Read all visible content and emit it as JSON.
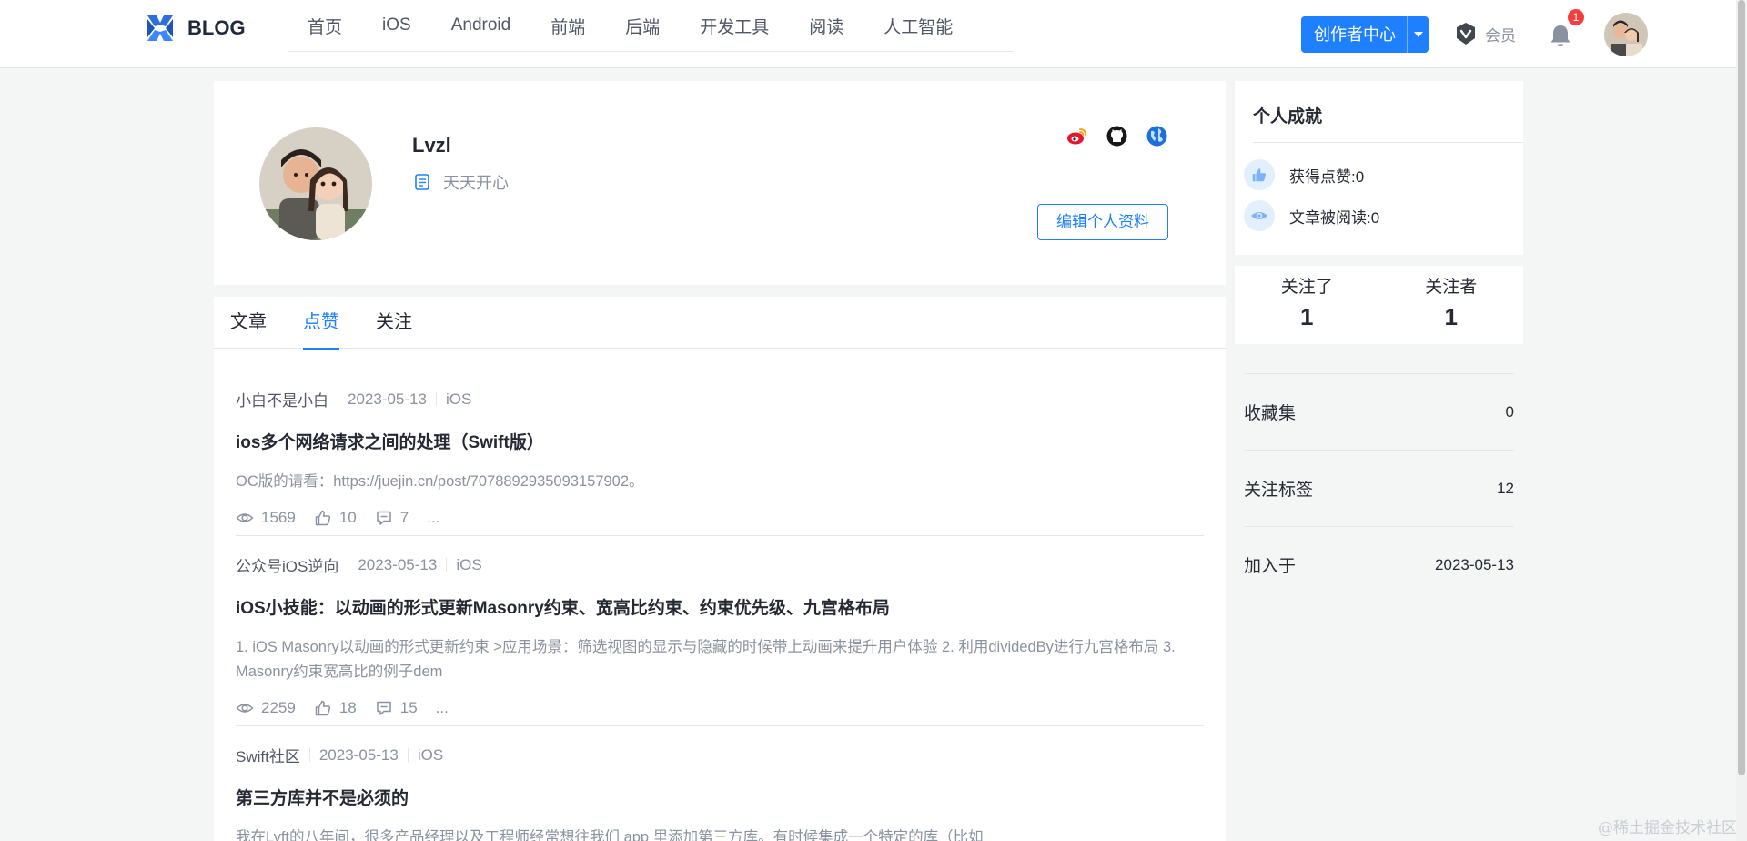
{
  "header": {
    "logo_text": "BLOG",
    "nav": [
      "首页",
      "iOS",
      "Android",
      "前端",
      "后端",
      "开发工具",
      "阅读",
      "人工智能"
    ],
    "creator_label": "创作者中心",
    "vip_label": "会员",
    "notification_count": "1",
    "accent": "#1e80ff"
  },
  "profile": {
    "name": "Lvzl",
    "signature": "天天开心",
    "edit_label": "编辑个人资料",
    "social_icons": [
      "weibo-icon",
      "github-icon",
      "website-icon"
    ]
  },
  "tabs": [
    {
      "label": "文章",
      "active": false
    },
    {
      "label": "点赞",
      "active": true
    },
    {
      "label": "关注",
      "active": false
    }
  ],
  "articles": [
    {
      "author": "小白不是小白",
      "date": "2023-05-13",
      "tag": "iOS",
      "title": "ios多个网络请求之间的处理（Swift版）",
      "abstract": "OC版的请看：https://juejin.cn/post/7078892935093157902。",
      "views": "1569",
      "likes": "10",
      "comments": "7",
      "more": "..."
    },
    {
      "author": "公众号iOS逆向",
      "date": "2023-05-13",
      "tag": "iOS",
      "title": "iOS小技能：以动画的形式更新Masonry约束、宽高比约束、约束优先级、九宫格布局",
      "abstract": "1. iOS Masonry以动画的形式更新约束 >应用场景：筛选视图的显示与隐藏的时候带上动画来提升用户体验 2. 利用dividedBy进行九宫格布局 3. Masonry约束宽高比的例子dem",
      "views": "2259",
      "likes": "18",
      "comments": "15",
      "more": "..."
    },
    {
      "author": "Swift社区",
      "date": "2023-05-13",
      "tag": "iOS",
      "title": "第三方库并不是必须的",
      "abstract": "我在Lyft的八年间，很多产品经理以及工程师经常想往我们 app 里添加第三方库。有时候集成一个特定的库（比如"
    }
  ],
  "sidebar": {
    "achievements_title": "个人成就",
    "likes_received": "获得点赞:0",
    "reads_received": "文章被阅读:0",
    "following_label": "关注了",
    "following_count": "1",
    "followers_label": "关注者",
    "followers_count": "1",
    "stats": [
      {
        "label": "收藏集",
        "value": "0"
      },
      {
        "label": "关注标签",
        "value": "12"
      },
      {
        "label": "加入于",
        "value": "2023-05-13"
      }
    ]
  },
  "watermark": "@稀土掘金技术社区"
}
